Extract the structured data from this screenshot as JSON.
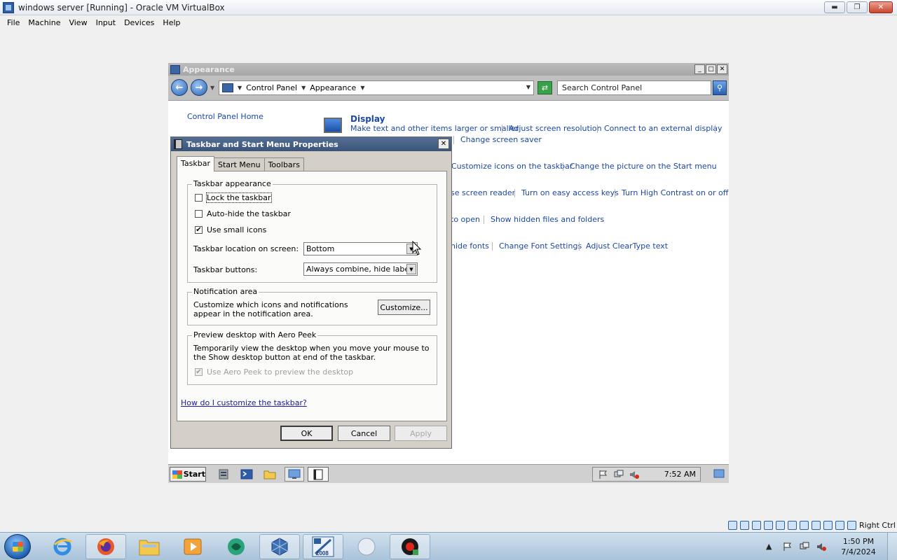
{
  "host_window": {
    "title": "windows server [Running] - Oracle VM VirtualBox",
    "menu": [
      "File",
      "Machine",
      "View",
      "Input",
      "Devices",
      "Help"
    ],
    "right_ctrl_label": "Right Ctrl"
  },
  "control_panel": {
    "title": "Appearance",
    "breadcrumb": [
      "Control Panel",
      "Appearance"
    ],
    "search_placeholder": "Search Control Panel",
    "home_link": "Control Panel Home",
    "display": {
      "title": "Display",
      "links": [
        "Make text and other items larger or smaller",
        "Adjust screen resolution",
        "Connect to an external display"
      ],
      "screen_saver_link": "Change screen saver"
    },
    "taskbar_links": [
      "Customize icons on the taskbar",
      "Change the picture on the Start menu"
    ],
    "ease_links": [
      "se screen reader",
      "Turn on easy access keys",
      "Turn High Contrast on or off"
    ],
    "folder_links": [
      "to open",
      "Show hidden files and folders"
    ],
    "font_links": [
      "hide fonts",
      "Change Font Settings",
      "Adjust ClearType text"
    ]
  },
  "dialog": {
    "title": "Taskbar and Start Menu Properties",
    "tabs": [
      "Taskbar",
      "Start Menu",
      "Toolbars"
    ],
    "appearance": {
      "group_title": "Taskbar appearance",
      "lock_label": "Lock the taskbar",
      "lock_checked": false,
      "autohide_label": "Auto-hide the taskbar",
      "autohide_checked": false,
      "small_icons_label": "Use small icons",
      "small_icons_checked": true,
      "location_label": "Taskbar location on screen:",
      "location_value": "Bottom",
      "buttons_label": "Taskbar buttons:",
      "buttons_value": "Always combine, hide labels"
    },
    "notification": {
      "group_title": "Notification area",
      "description": "Customize which icons and notifications appear in the notification area.",
      "customize_button": "Customize..."
    },
    "aero_peek": {
      "group_title": "Preview desktop with Aero Peek",
      "description": "Temporarily view the desktop when you move your mouse to the Show desktop button at end of the taskbar.",
      "checkbox_label": "Use Aero Peek to preview the desktop",
      "checkbox_checked": true
    },
    "help_link": "How do I customize the taskbar?",
    "buttons": {
      "ok": "OK",
      "cancel": "Cancel",
      "apply": "Apply"
    }
  },
  "guest_taskbar": {
    "start_label": "Start",
    "clock": "7:52 AM"
  },
  "host_taskbar": {
    "apps": [
      "internet-explorer",
      "firefox",
      "file-explorer",
      "media-player",
      "app-green",
      "virtualbox",
      "windows-server-2008",
      "app-white",
      "screen-recorder"
    ],
    "server_badge": "2008",
    "clock_time": "1:50 PM",
    "clock_date": "7/4/2024"
  },
  "colors": {
    "link": "#1a47a8",
    "dialog_title_bg": "#3b5479",
    "host_taskbar": "#a9c3d9"
  }
}
